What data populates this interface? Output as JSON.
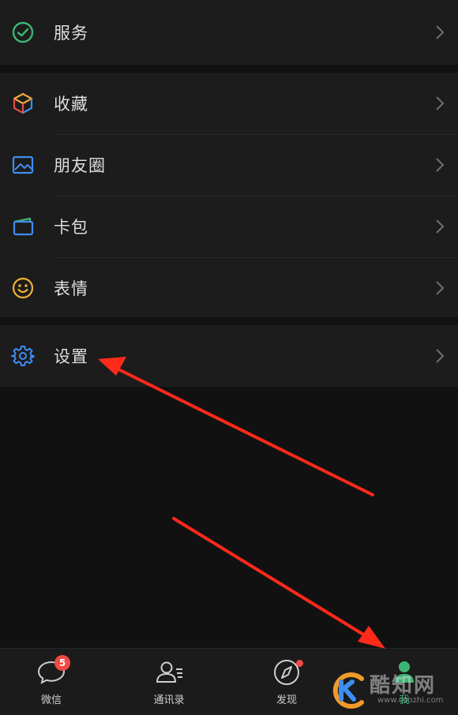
{
  "groups": [
    {
      "items": [
        {
          "label": "服务",
          "icon": "wechat-pay-icon"
        }
      ]
    },
    {
      "items": [
        {
          "label": "收藏",
          "icon": "favorites-cube-icon"
        },
        {
          "label": "朋友圈",
          "icon": "moments-picture-icon"
        },
        {
          "label": "卡包",
          "icon": "card-wallet-icon"
        },
        {
          "label": "表情",
          "icon": "sticker-smiley-icon"
        }
      ]
    },
    {
      "items": [
        {
          "label": "设置",
          "icon": "gear-icon"
        }
      ]
    }
  ],
  "tabbar": {
    "tabs": [
      {
        "label": "微信",
        "icon": "chat-bubble-icon",
        "badge": "5"
      },
      {
        "label": "通讯录",
        "icon": "contacts-icon"
      },
      {
        "label": "发现",
        "icon": "compass-icon",
        "dot": true
      },
      {
        "label": "我",
        "icon": "person-icon",
        "active": true
      }
    ]
  },
  "watermark": {
    "text": "酷知网",
    "sub": "www.coozhi.com"
  },
  "colors": {
    "background": "#111111",
    "row_background": "#1c1c1c",
    "accent_green": "#3eb575",
    "badge_red": "#f04a43",
    "arrow_red": "#ff2a1a"
  }
}
